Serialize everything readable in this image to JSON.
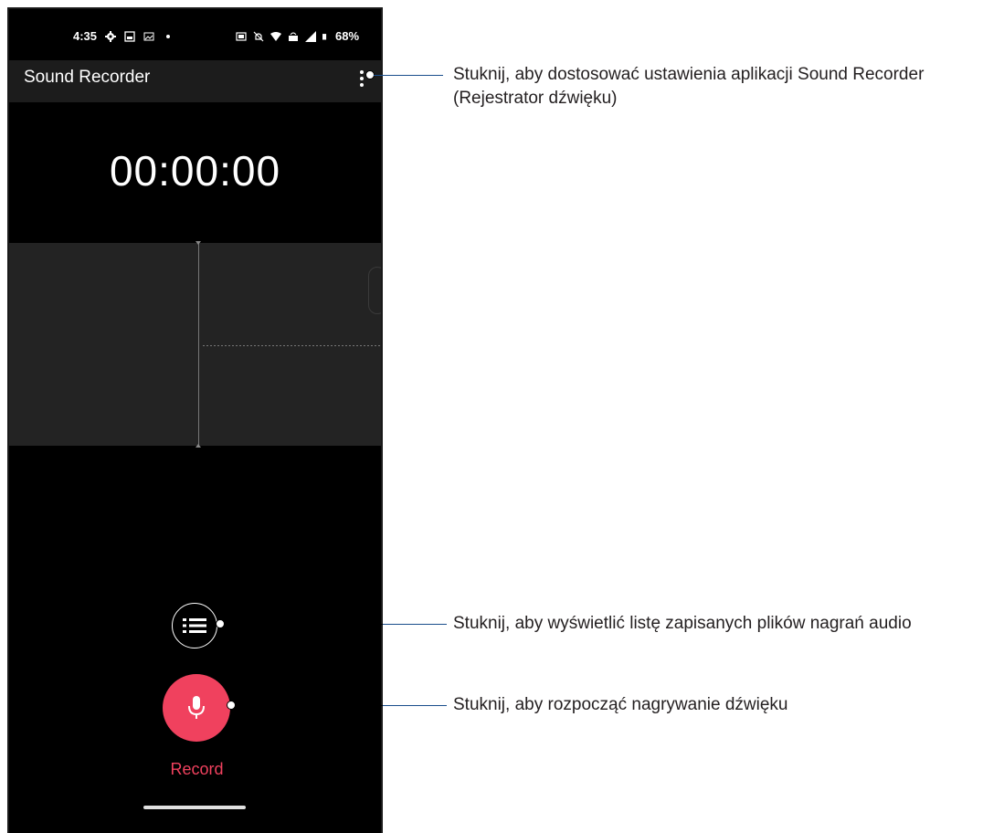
{
  "status_bar": {
    "time": "4:35",
    "battery": "68%"
  },
  "app": {
    "title": "Sound Recorder"
  },
  "timer": {
    "value": "00:00:00"
  },
  "controls": {
    "record_label": "Record"
  },
  "callouts": {
    "menu": "Stuknij, aby dostosować ustawienia aplikacji Sound Recorder (Rejestrator dźwięku)",
    "list": "Stuknij, aby wyświetlić listę zapisanych plików nagrań audio",
    "record": "Stuknij, aby rozpocząć nagrywanie dźwięku"
  },
  "colors": {
    "accent": "#f0415e",
    "background": "#000000",
    "waveform_bg": "#232323"
  }
}
